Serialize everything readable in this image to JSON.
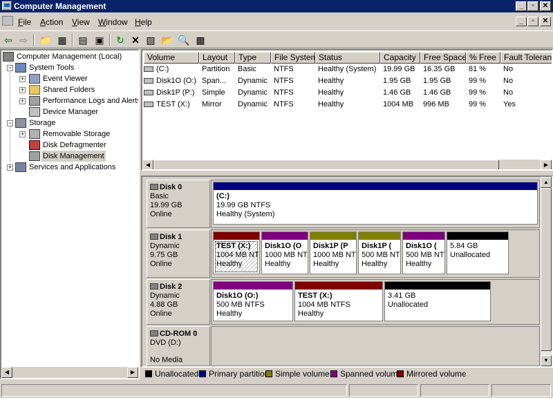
{
  "window": {
    "title": "Computer Management"
  },
  "menu": [
    {
      "pre": "",
      "key": "F",
      "post": "ile"
    },
    {
      "pre": "",
      "key": "A",
      "post": "ction"
    },
    {
      "pre": "",
      "key": "V",
      "post": "iew"
    },
    {
      "pre": "",
      "key": "W",
      "post": "indow"
    },
    {
      "pre": "",
      "key": "H",
      "post": "elp"
    }
  ],
  "tree": {
    "root": "Computer Management (Local)",
    "system_tools": "System Tools",
    "event_viewer": "Event Viewer",
    "shared_folders": "Shared Folders",
    "perf_logs": "Performance Logs and Alerts",
    "device_manager": "Device Manager",
    "storage": "Storage",
    "removable_storage": "Removable Storage",
    "disk_defragmenter": "Disk Defragmenter",
    "disk_management": "Disk Management",
    "services": "Services and Applications"
  },
  "volumes": {
    "columns": [
      "Volume",
      "Layout",
      "Type",
      "File System",
      "Status",
      "Capacity",
      "Free Space",
      "% Free",
      "Fault Tolerance"
    ],
    "rows": [
      [
        "(C:)",
        "Partition",
        "Basic",
        "NTFS",
        "Healthy (System)",
        "19.99 GB",
        "16.35 GB",
        "81 %",
        "No"
      ],
      [
        "Disk1O (O:)",
        "Span...",
        "Dynamic",
        "NTFS",
        "Healthy",
        "1.95 GB",
        "1.95 GB",
        "99 %",
        "No"
      ],
      [
        "Disk1P (P:)",
        "Simple",
        "Dynamic",
        "NTFS",
        "Healthy",
        "1.46 GB",
        "1.46 GB",
        "99 %",
        "No"
      ],
      [
        "TEST (X:)",
        "Mirror",
        "Dynamic",
        "NTFS",
        "Healthy",
        "1004 MB",
        "996 MB",
        "99 %",
        "Yes"
      ]
    ]
  },
  "disks": [
    {
      "name": "Disk 0",
      "type": "Basic",
      "size": "19.99 GB",
      "status": "Online",
      "parts": [
        {
          "l1": "(C:)",
          "l2": "19.99 GB NTFS",
          "l3": "Healthy (System)",
          "color": "#000080"
        }
      ]
    },
    {
      "name": "Disk 1",
      "type": "Dynamic",
      "size": "9.75 GB",
      "status": "Online",
      "parts": [
        {
          "l1": "TEST  (X:)",
          "l2": "1004 MB NT",
          "l3": "Healthy",
          "color": "#800000"
        },
        {
          "l1": "Disk1O  (O",
          "l2": "1000 MB NT",
          "l3": "Healthy",
          "color": "#800080"
        },
        {
          "l1": "Disk1P  (P",
          "l2": "1000 MB NT",
          "l3": "Healthy",
          "color": "#808000"
        },
        {
          "l1": "Disk1P  (",
          "l2": "500 MB NT",
          "l3": "Healthy",
          "color": "#808000"
        },
        {
          "l1": "Disk1O  (",
          "l2": "500 MB NT",
          "l3": "Healthy",
          "color": "#800080"
        },
        {
          "l1": "",
          "l2": "5.84 GB",
          "l3": "Unallocated",
          "color": "#000000"
        }
      ]
    },
    {
      "name": "Disk 2",
      "type": "Dynamic",
      "size": "4.88 GB",
      "status": "Online",
      "parts": [
        {
          "l1": "Disk1O  (O:)",
          "l2": "500 MB NTFS",
          "l3": "Healthy",
          "color": "#800080"
        },
        {
          "l1": "TEST  (X:)",
          "l2": "1004 MB NTFS",
          "l3": "Healthy",
          "color": "#800000"
        },
        {
          "l1": "",
          "l2": "3.41 GB",
          "l3": "Unallocated",
          "color": "#000000"
        }
      ]
    },
    {
      "name": "CD-ROM 0",
      "type": "DVD (D:)",
      "size": "",
      "status": "No Media",
      "parts": []
    }
  ],
  "legend": [
    {
      "label": "Unallocated",
      "color": "#000000"
    },
    {
      "label": "Primary partition",
      "color": "#000080"
    },
    {
      "label": "Simple volume",
      "color": "#808000"
    },
    {
      "label": "Spanned volume",
      "color": "#800080"
    },
    {
      "label": "Mirrored volume",
      "color": "#800000"
    }
  ]
}
